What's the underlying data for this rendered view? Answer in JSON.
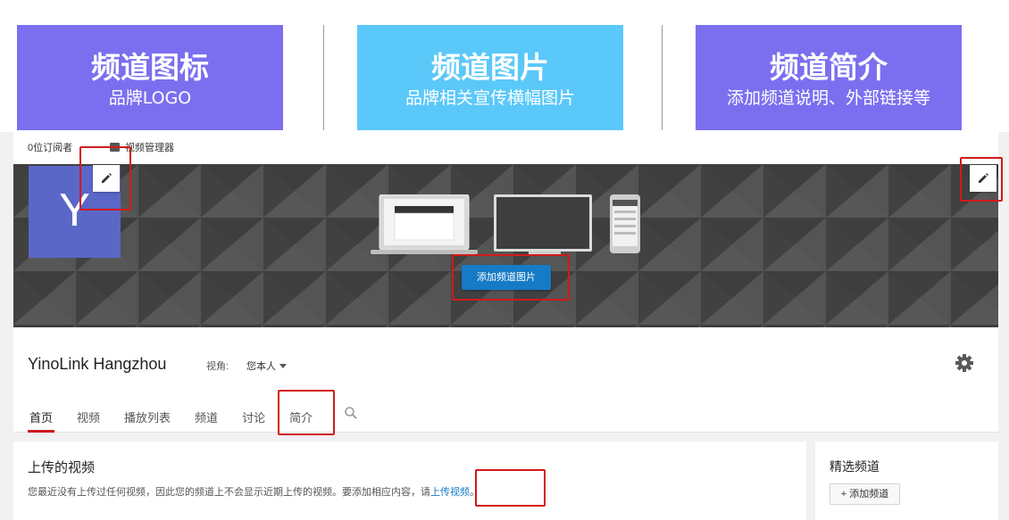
{
  "callouts": [
    {
      "title": "频道图标",
      "subtitle": "品牌LOGO"
    },
    {
      "title": "频道图片",
      "subtitle": "品牌相关宣传横幅图片"
    },
    {
      "title": "频道简介",
      "subtitle": "添加频道说明、外部链接等"
    }
  ],
  "topbar": {
    "subscribers": "0位订阅者",
    "video_manager": "视频管理器"
  },
  "avatar": {
    "letter": "Y"
  },
  "banner": {
    "add_art_button": "添加频道图片"
  },
  "channel": {
    "name": "YinoLink Hangzhou",
    "view_as_label": "视角:",
    "view_as_value": "您本人"
  },
  "tabs": [
    "首页",
    "视频",
    "播放列表",
    "频道",
    "讨论",
    "简介"
  ],
  "uploads": {
    "title": "上传的视频",
    "description": "您最近没有上传过任何视频，因此您的频道上不会显示近期上传的视频。要添加相应内容，请",
    "link": "上传视频",
    "suffix": "。"
  },
  "featured": {
    "title": "精选频道",
    "add_button": "+ 添加频道"
  },
  "colors": {
    "callout_purple": "#7b6ff0",
    "callout_blue": "#5bc8fa",
    "avatar": "#5b67c7",
    "button_blue": "#167ac6",
    "tab_active": "#cc181e",
    "highlight_red": "#d21a1a"
  }
}
